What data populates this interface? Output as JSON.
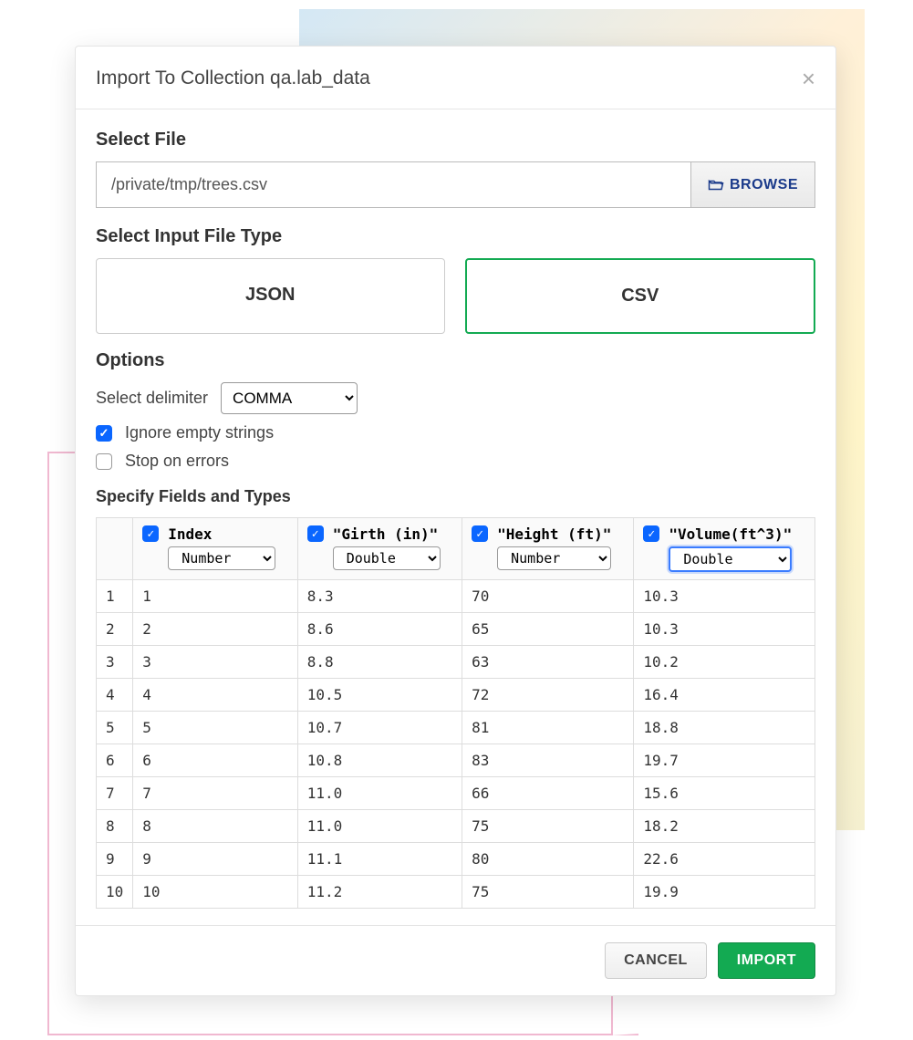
{
  "header": {
    "title": "Import To Collection qa.lab_data"
  },
  "file": {
    "section_label": "Select File",
    "path": "/private/tmp/trees.csv",
    "browse_label": "BROWSE"
  },
  "filetype": {
    "section_label": "Select Input File Type",
    "options": [
      "JSON",
      "CSV"
    ],
    "selected": "CSV"
  },
  "options": {
    "section_label": "Options",
    "delimiter_label": "Select delimiter",
    "delimiter_value": "COMMA",
    "ignore_empty": {
      "label": "Ignore empty strings",
      "checked": true
    },
    "stop_on_errors": {
      "label": "Stop on errors",
      "checked": false
    }
  },
  "fields": {
    "section_label": "Specify Fields and Types",
    "columns": [
      {
        "name": "Index",
        "type": "Number",
        "checked": true,
        "quoted": false,
        "focused": false
      },
      {
        "name": "\"Girth (in)\"",
        "type": "Double",
        "checked": true,
        "quoted": true,
        "focused": false
      },
      {
        "name": "\"Height (ft)\"",
        "type": "Number",
        "checked": true,
        "quoted": true,
        "focused": false
      },
      {
        "name": "\"Volume(ft^3)\"",
        "type": "Double",
        "checked": true,
        "quoted": true,
        "focused": true
      }
    ],
    "rows": [
      {
        "idx": "1",
        "cells": [
          "1",
          "8.3",
          "70",
          "10.3"
        ]
      },
      {
        "idx": "2",
        "cells": [
          "2",
          "8.6",
          "65",
          "10.3"
        ]
      },
      {
        "idx": "3",
        "cells": [
          "3",
          "8.8",
          "63",
          "10.2"
        ]
      },
      {
        "idx": "4",
        "cells": [
          "4",
          "10.5",
          "72",
          "16.4"
        ]
      },
      {
        "idx": "5",
        "cells": [
          "5",
          "10.7",
          "81",
          "18.8"
        ]
      },
      {
        "idx": "6",
        "cells": [
          "6",
          "10.8",
          "83",
          "19.7"
        ]
      },
      {
        "idx": "7",
        "cells": [
          "7",
          "11.0",
          "66",
          "15.6"
        ]
      },
      {
        "idx": "8",
        "cells": [
          "8",
          "11.0",
          "75",
          "18.2"
        ]
      },
      {
        "idx": "9",
        "cells": [
          "9",
          "11.1",
          "80",
          "22.6"
        ]
      },
      {
        "idx": "10",
        "cells": [
          "10",
          "11.2",
          "75",
          "19.9"
        ]
      }
    ]
  },
  "footer": {
    "cancel_label": "CANCEL",
    "import_label": "IMPORT"
  }
}
